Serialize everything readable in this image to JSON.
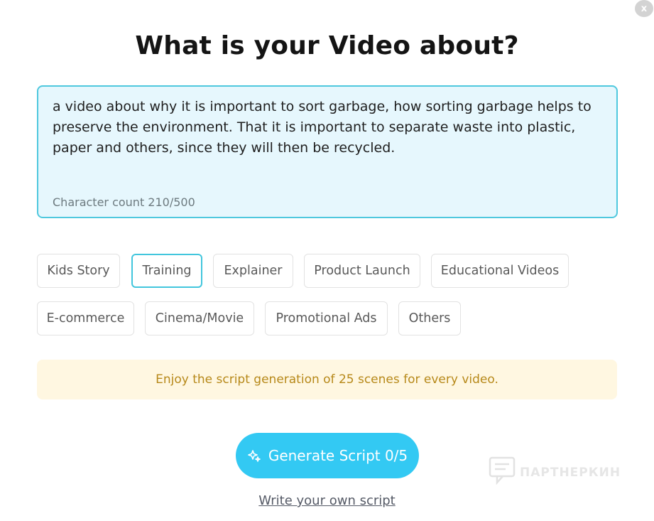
{
  "dialog": {
    "close_label": "x",
    "title": "What is your Video about?"
  },
  "prompt": {
    "text": "a video about why it is important to sort garbage, how sorting garbage helps to preserve the environment. That it is important to separate waste into plastic, paper and others, since they will then be recycled.",
    "char_count": "Character count 210/500"
  },
  "categories": [
    {
      "label": "Kids Story",
      "selected": false
    },
    {
      "label": "Training",
      "selected": true
    },
    {
      "label": "Explainer",
      "selected": false
    },
    {
      "label": "Product Launch",
      "selected": false
    },
    {
      "label": "Educational Videos",
      "selected": false
    },
    {
      "label": "E-commerce",
      "selected": false
    },
    {
      "label": "Cinema/Movie",
      "selected": false
    },
    {
      "label": "Promotional Ads",
      "selected": false
    },
    {
      "label": "Others",
      "selected": false
    }
  ],
  "banner": {
    "text": "Enjoy the script generation of 25 scenes for every video."
  },
  "actions": {
    "generate_label": "Generate Script 0/5",
    "generate_icon": "sparkle-icon",
    "own_script_label": "Write your own script"
  },
  "watermark": {
    "text": "ПАРТНЕРКИН"
  },
  "colors": {
    "accent": "#33c9f3",
    "textbox_border": "#4fc8de",
    "textbox_bg": "#e6f7fd",
    "banner_bg": "#fff7e1",
    "banner_text": "#b7891a"
  }
}
